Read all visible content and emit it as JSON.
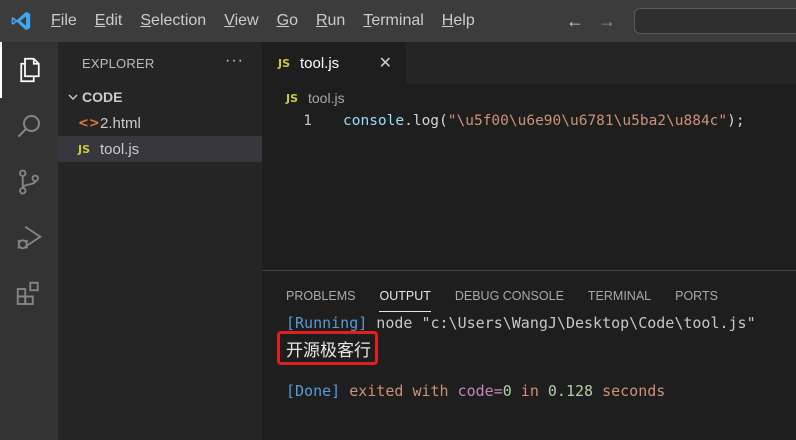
{
  "titlebar": {
    "menu": [
      {
        "mnemonic": "F",
        "rest": "ile"
      },
      {
        "mnemonic": "E",
        "rest": "dit"
      },
      {
        "mnemonic": "S",
        "rest": "election"
      },
      {
        "mnemonic": "V",
        "rest": "iew"
      },
      {
        "mnemonic": "G",
        "rest": "o"
      },
      {
        "mnemonic": "R",
        "rest": "un"
      },
      {
        "mnemonic": "T",
        "rest": "erminal"
      },
      {
        "mnemonic": "H",
        "rest": "elp"
      }
    ],
    "back_icon": "←",
    "forward_icon": "→"
  },
  "activitybar": {
    "icons": [
      "explorer-icon",
      "search-icon",
      "source-control-icon",
      "run-debug-icon",
      "extensions-icon"
    ]
  },
  "sidebar": {
    "title": "EXPLORER",
    "more": "···",
    "folder": "CODE",
    "files": [
      {
        "icon": "<>",
        "name": "2.html",
        "type": "html"
      },
      {
        "icon": "JS",
        "name": "tool.js",
        "type": "js"
      }
    ]
  },
  "editor": {
    "tab": {
      "icon": "JS",
      "label": "tool.js",
      "close": "✕"
    },
    "breadcrumb": {
      "icon": "JS",
      "label": "tool.js"
    },
    "line_number": "1",
    "code": {
      "fn": "console",
      "dot": ".",
      "method": "log",
      "open": "(",
      "string": "\"\\u5f00\\u6e90\\u6781\\u5ba2\\u884c\"",
      "close": ");"
    }
  },
  "panel": {
    "tabs": [
      "PROBLEMS",
      "OUTPUT",
      "DEBUG CONSOLE",
      "TERMINAL",
      "PORTS"
    ],
    "active_tab": "OUTPUT",
    "running": {
      "tag": "[Running]",
      "cmd": " node ",
      "path": "\"c:\\Users\\WangJ\\Desktop\\Code\\tool.js\""
    },
    "output_text": "开源极客行",
    "done": {
      "tag": "[Done]",
      "exited": " exited ",
      "with": "with ",
      "code": "code=",
      "code_val": "0",
      "in": " in ",
      "seconds_val": "0.128",
      "seconds": " seconds"
    }
  }
}
